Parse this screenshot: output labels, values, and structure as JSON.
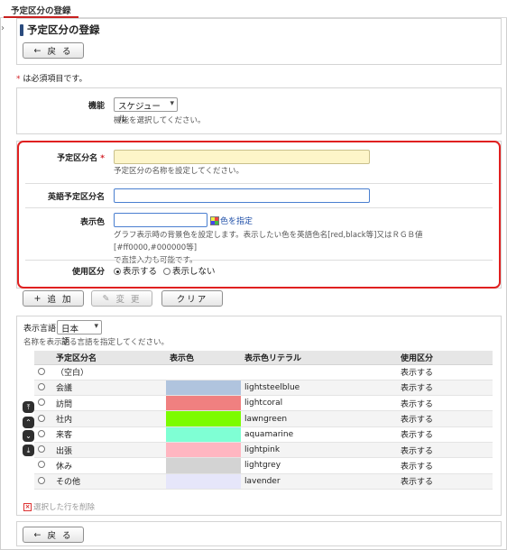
{
  "tab": {
    "label": "予定区分の登録"
  },
  "header": {
    "title": "予定区分の登録"
  },
  "buttons": {
    "back": "戻 る",
    "add": "追 加",
    "change": "変 更",
    "clear": "クリア"
  },
  "required_note": {
    "mark": "*",
    "text": " は必須項目です。"
  },
  "function": {
    "label": "機能",
    "value": "スケジュール",
    "help": "機能を選択してください。"
  },
  "form": {
    "name": {
      "label": "予定区分名",
      "required_mark": "*",
      "value": "",
      "help": "予定区分の名称を設定してください。"
    },
    "english_name": {
      "label": "英語予定区分名",
      "value": ""
    },
    "display_color": {
      "label": "表示色",
      "value": "",
      "picker": "色を指定",
      "help1": "グラフ表示時の背景色を設定します。表示したい色を英語色名[red,black等]又はＲＧＢ値[#ff0000,#000000等]",
      "help2": "で直接入力も可能です。"
    },
    "usage": {
      "label": "使用区分",
      "option_show": "表示する",
      "option_hide": "表示しない",
      "selected": "表示する"
    }
  },
  "language": {
    "label": "表示言語",
    "value": "日本語",
    "help": "名称を表示する言語を指定してください。"
  },
  "table": {
    "headers": [
      "予定区分名",
      "表示色",
      "表示色リテラル",
      "使用区分"
    ],
    "rows": [
      {
        "name": "（空白）",
        "color": "",
        "literal": "",
        "usage": "表示する"
      },
      {
        "name": "会議",
        "color": "#b0c4de",
        "literal": "lightsteelblue",
        "usage": "表示する"
      },
      {
        "name": "訪問",
        "color": "#f08080",
        "literal": "lightcoral",
        "usage": "表示する"
      },
      {
        "name": "社内",
        "color": "#7cfc00",
        "literal": "lawngreen",
        "usage": "表示する"
      },
      {
        "name": "来客",
        "color": "#7fffd4",
        "literal": "aquamarine",
        "usage": "表示する"
      },
      {
        "name": "出張",
        "color": "#ffb6c1",
        "literal": "lightpink",
        "usage": "表示する"
      },
      {
        "name": "休み",
        "color": "#d3d3d3",
        "literal": "lightgrey",
        "usage": "表示する"
      },
      {
        "name": "その他",
        "color": "#e6e6fa",
        "literal": "lavender",
        "usage": "表示する"
      }
    ]
  },
  "delete_rows": {
    "label": "選択した行を削除"
  },
  "colors": {
    "accent": "#e02020",
    "title_mark": "#2b4c7e",
    "required_bg": "#fdf5c9"
  }
}
